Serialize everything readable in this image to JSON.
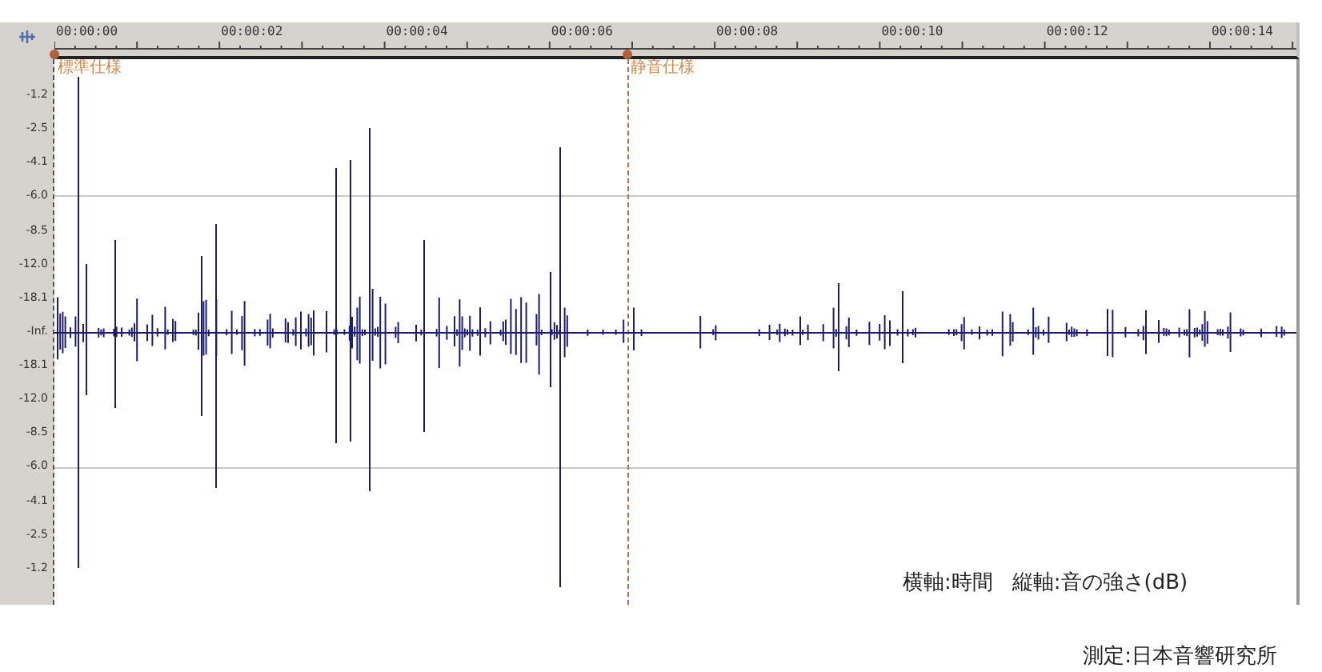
{
  "ruler": {
    "labels": [
      "00:00:00",
      "00:00:02",
      "00:00:04",
      "00:00:06",
      "00:00:08",
      "00:00:10",
      "00:00:12",
      "00:00:14"
    ]
  },
  "markers": [
    {
      "label": "標準仕様"
    },
    {
      "label": "静音仕様"
    }
  ],
  "level_axis": {
    "labels": [
      "-1.2",
      "-2.5",
      "-4.1",
      "-6.0",
      "-8.5",
      "-12.0",
      "-18.1",
      "-Inf.",
      "-18.1",
      "-12.0",
      "-8.5",
      "-6.0",
      "-4.1",
      "-2.5",
      "-1.2"
    ]
  },
  "captions": {
    "horizontal_axis": "横軸:時間",
    "vertical_axis": "縦軸:音の強さ(dB)",
    "credit": "測定:日本音響研究所"
  }
}
